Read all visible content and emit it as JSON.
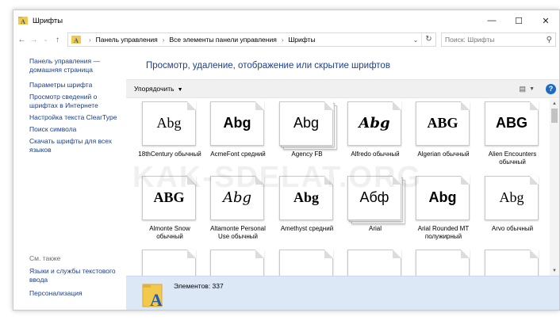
{
  "window": {
    "title": "Шрифты",
    "minimize_glyph": "—",
    "maximize_glyph": "☐",
    "close_glyph": "✕"
  },
  "address": {
    "crumbs": [
      "Панель управления",
      "Все элементы панели управления",
      "Шрифты"
    ],
    "separator": "›"
  },
  "search": {
    "placeholder": "Поиск: Шрифты"
  },
  "sidebar": {
    "home": "Панель управления — домашняя страница",
    "tasks": [
      "Параметры шрифта",
      "Просмотр сведений о шрифтах в Интернете",
      "Настройка текста ClearType",
      "Поиск символа",
      "Скачать шрифты для всех языков"
    ],
    "see_also_title": "См. также",
    "see_also": [
      "Языки и службы текстового ввода",
      "Персонализация"
    ]
  },
  "main": {
    "title": "Просмотр, удаление, отображение или скрытие шрифтов",
    "organize": "Упорядочить",
    "help": "?"
  },
  "fonts": [
    {
      "sample": "Abg",
      "label": "18thCentury обычный",
      "stacked": false,
      "font": "serif",
      "weight": "normal"
    },
    {
      "sample": "Abg",
      "label": "AcmeFont средний",
      "stacked": false,
      "font": "sans",
      "weight": "bold"
    },
    {
      "sample": "Abg",
      "label": "Agency FB",
      "stacked": true,
      "font": "sans",
      "weight": "normal"
    },
    {
      "sample": "Abg",
      "label": "Alfredo обычный",
      "stacked": false,
      "font": "script",
      "weight": "bold"
    },
    {
      "sample": "ABG",
      "label": "Algerian обычный",
      "stacked": false,
      "font": "serif",
      "weight": "bold"
    },
    {
      "sample": "ABG",
      "label": "Alien Encounters обычный",
      "stacked": false,
      "font": "sans",
      "weight": "bold"
    },
    {
      "sample": "ABG",
      "label": "Almonte Snow обычный",
      "stacked": false,
      "font": "serif",
      "weight": "bold"
    },
    {
      "sample": "Abg",
      "label": "Altamonte Personal Use обычный",
      "stacked": false,
      "font": "script",
      "weight": "normal"
    },
    {
      "sample": "Abg",
      "label": "Amethyst средний",
      "stacked": false,
      "font": "serif",
      "weight": "bold"
    },
    {
      "sample": "Абф",
      "label": "Arial",
      "stacked": true,
      "font": "sans",
      "weight": "normal"
    },
    {
      "sample": "Abg",
      "label": "Arial Rounded MT полужирный",
      "stacked": false,
      "font": "sans",
      "weight": "bold"
    },
    {
      "sample": "Abg",
      "label": "Arvo обычный",
      "stacked": false,
      "font": "serif",
      "weight": "normal"
    },
    {
      "sample": "",
      "label": "",
      "stacked": false,
      "font": "sans",
      "weight": "normal"
    },
    {
      "sample": "",
      "label": "",
      "stacked": false,
      "font": "sans",
      "weight": "normal"
    },
    {
      "sample": "",
      "label": "",
      "stacked": false,
      "font": "sans",
      "weight": "normal"
    },
    {
      "sample": "",
      "label": "",
      "stacked": false,
      "font": "sans",
      "weight": "normal"
    },
    {
      "sample": "",
      "label": "",
      "stacked": false,
      "font": "sans",
      "weight": "normal"
    },
    {
      "sample": "",
      "label": "",
      "stacked": false,
      "font": "sans",
      "weight": "normal"
    }
  ],
  "details": {
    "count": "Элементов: 337"
  },
  "watermark": "KAK-SDELAT.ORG"
}
